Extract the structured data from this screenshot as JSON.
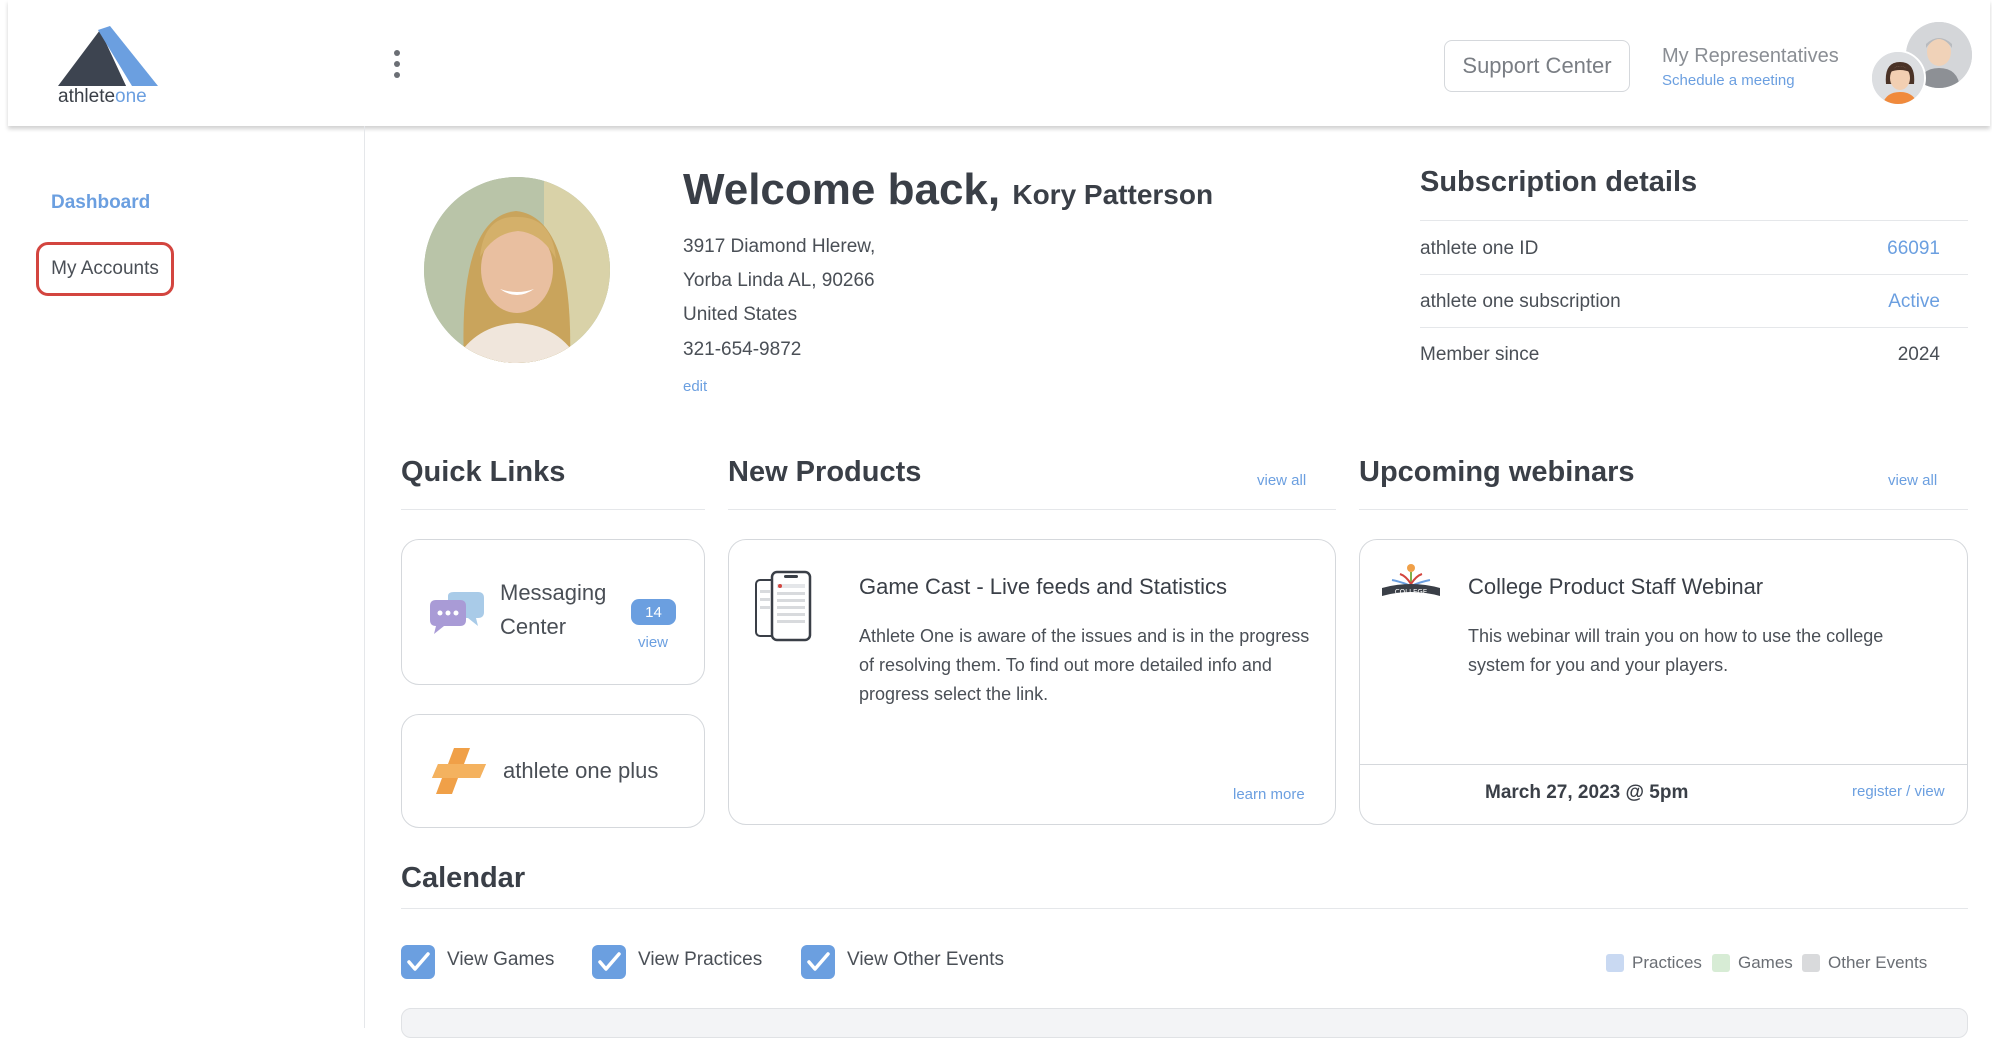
{
  "header": {
    "logo_main": "athlete",
    "logo_accent": "one",
    "support_label": "Support Center",
    "reps_title": "My Representatives",
    "reps_link": "Schedule a meeting"
  },
  "sidebar": {
    "items": [
      {
        "label": "Dashboard"
      },
      {
        "label": "My Accounts"
      }
    ]
  },
  "profile": {
    "welcome": "Welcome back,",
    "name": "Kory Patterson",
    "address_line1": "3917 Diamond Hlerew,",
    "address_line2": "Yorba Linda AL, 90266",
    "country": "United States",
    "phone": "321-654-9872",
    "edit": "edit"
  },
  "subscription": {
    "title": "Subscription details",
    "rows": [
      {
        "label": "athlete one ID",
        "value": "66091"
      },
      {
        "label": "athlete one subscription",
        "value": "Active"
      },
      {
        "label": "Member since",
        "value": "2024"
      }
    ]
  },
  "quick_links": {
    "title": "Quick Links",
    "messaging_line1": "Messaging",
    "messaging_line2": "Center",
    "messaging_count": "14",
    "messaging_view": "view",
    "plus_label": "athlete one plus"
  },
  "new_products": {
    "title": "New Products",
    "view_all": "view all",
    "item_title": "Game Cast - Live feeds and Statistics",
    "item_desc": "Athlete One is aware of the issues and is in the progress of resolving them. To find out more detailed info and progress select the link.",
    "learn_more": "learn more"
  },
  "webinars": {
    "title": "Upcoming webinars",
    "view_all": "view all",
    "logo_text": "COLLEGE",
    "item_title": "College Product Staff Webinar",
    "item_desc": "This webinar will train you on how to use the college system for you and your players.",
    "date": "March 27, 2023 @ 5pm",
    "register": "register / view"
  },
  "calendar": {
    "title": "Calendar",
    "filters": [
      {
        "label": "View Games",
        "checked": true
      },
      {
        "label": "View Practices",
        "checked": true
      },
      {
        "label": "View Other Events",
        "checked": true
      }
    ],
    "legend": [
      {
        "label": "Practices",
        "color": "#c9d9f2"
      },
      {
        "label": "Games",
        "color": "#d7ecd5"
      },
      {
        "label": "Other Events",
        "color": "#d9dadc"
      }
    ]
  },
  "colors": {
    "accent": "#6b9fe0",
    "highlight": "#d3453f"
  }
}
